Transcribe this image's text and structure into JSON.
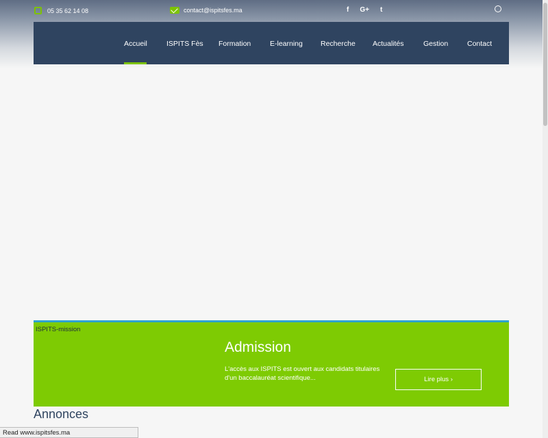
{
  "topbar": {
    "phone": "05 35 62 14 08",
    "email": "contact@ispitsfes.ma",
    "social": [
      "f",
      "G+",
      "t"
    ],
    "icons": {
      "phone": "phone-icon",
      "email": "mail-icon",
      "search": "search-icon"
    }
  },
  "nav": {
    "items": [
      "Accueil",
      "ISPITS Fès",
      "Formation",
      "E-learning",
      "Recherche",
      "Actualités",
      "Gestion",
      "Contact"
    ],
    "active": "Accueil"
  },
  "hero": {
    "mission_label": "ISPITS-mission",
    "title": "Admission",
    "text": "L'accès aux ISPITS est ouvert aux candidats titulaires d'un baccalauréat scientifique...",
    "button": "Lire plus ›"
  },
  "section_title": "Annonces",
  "status": "Read www.ispitsfes.ma",
  "colors": {
    "nav": "#2f4460",
    "accent": "#7dc300",
    "panel": "#7ecb03",
    "line": "#2ea3d1"
  }
}
